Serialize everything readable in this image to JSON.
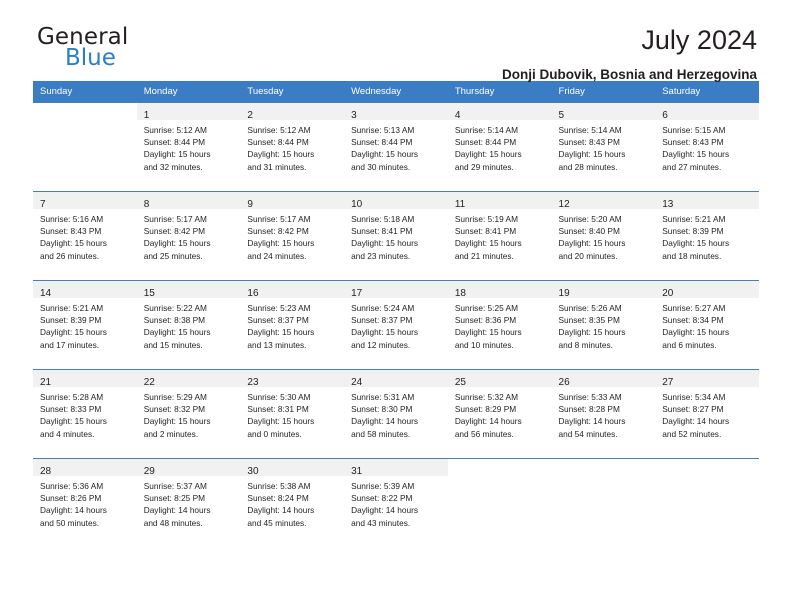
{
  "brand": {
    "name_top": "General",
    "name_bottom": "Blue",
    "triangle_color": "#1b6cb5",
    "blue_color": "#2a7fc9"
  },
  "header": {
    "title": "July 2024",
    "location": "Donji Dubovik, Bosnia and Herzegovina"
  },
  "theme": {
    "header_row_bg": "#3b7dc4",
    "cell_top_border": "#4a7ebb",
    "daynum_bg": "#f1f1f1"
  },
  "weekdays": [
    "Sunday",
    "Monday",
    "Tuesday",
    "Wednesday",
    "Thursday",
    "Friday",
    "Saturday"
  ],
  "weeks": [
    [
      {
        "day": "",
        "sunrise": "",
        "sunset": "",
        "daylight1": "",
        "daylight2": ""
      },
      {
        "day": "1",
        "sunrise": "Sunrise: 5:12 AM",
        "sunset": "Sunset: 8:44 PM",
        "daylight1": "Daylight: 15 hours",
        "daylight2": "and 32 minutes."
      },
      {
        "day": "2",
        "sunrise": "Sunrise: 5:12 AM",
        "sunset": "Sunset: 8:44 PM",
        "daylight1": "Daylight: 15 hours",
        "daylight2": "and 31 minutes."
      },
      {
        "day": "3",
        "sunrise": "Sunrise: 5:13 AM",
        "sunset": "Sunset: 8:44 PM",
        "daylight1": "Daylight: 15 hours",
        "daylight2": "and 30 minutes."
      },
      {
        "day": "4",
        "sunrise": "Sunrise: 5:14 AM",
        "sunset": "Sunset: 8:44 PM",
        "daylight1": "Daylight: 15 hours",
        "daylight2": "and 29 minutes."
      },
      {
        "day": "5",
        "sunrise": "Sunrise: 5:14 AM",
        "sunset": "Sunset: 8:43 PM",
        "daylight1": "Daylight: 15 hours",
        "daylight2": "and 28 minutes."
      },
      {
        "day": "6",
        "sunrise": "Sunrise: 5:15 AM",
        "sunset": "Sunset: 8:43 PM",
        "daylight1": "Daylight: 15 hours",
        "daylight2": "and 27 minutes."
      }
    ],
    [
      {
        "day": "7",
        "sunrise": "Sunrise: 5:16 AM",
        "sunset": "Sunset: 8:43 PM",
        "daylight1": "Daylight: 15 hours",
        "daylight2": "and 26 minutes."
      },
      {
        "day": "8",
        "sunrise": "Sunrise: 5:17 AM",
        "sunset": "Sunset: 8:42 PM",
        "daylight1": "Daylight: 15 hours",
        "daylight2": "and 25 minutes."
      },
      {
        "day": "9",
        "sunrise": "Sunrise: 5:17 AM",
        "sunset": "Sunset: 8:42 PM",
        "daylight1": "Daylight: 15 hours",
        "daylight2": "and 24 minutes."
      },
      {
        "day": "10",
        "sunrise": "Sunrise: 5:18 AM",
        "sunset": "Sunset: 8:41 PM",
        "daylight1": "Daylight: 15 hours",
        "daylight2": "and 23 minutes."
      },
      {
        "day": "11",
        "sunrise": "Sunrise: 5:19 AM",
        "sunset": "Sunset: 8:41 PM",
        "daylight1": "Daylight: 15 hours",
        "daylight2": "and 21 minutes."
      },
      {
        "day": "12",
        "sunrise": "Sunrise: 5:20 AM",
        "sunset": "Sunset: 8:40 PM",
        "daylight1": "Daylight: 15 hours",
        "daylight2": "and 20 minutes."
      },
      {
        "day": "13",
        "sunrise": "Sunrise: 5:21 AM",
        "sunset": "Sunset: 8:39 PM",
        "daylight1": "Daylight: 15 hours",
        "daylight2": "and 18 minutes."
      }
    ],
    [
      {
        "day": "14",
        "sunrise": "Sunrise: 5:21 AM",
        "sunset": "Sunset: 8:39 PM",
        "daylight1": "Daylight: 15 hours",
        "daylight2": "and 17 minutes."
      },
      {
        "day": "15",
        "sunrise": "Sunrise: 5:22 AM",
        "sunset": "Sunset: 8:38 PM",
        "daylight1": "Daylight: 15 hours",
        "daylight2": "and 15 minutes."
      },
      {
        "day": "16",
        "sunrise": "Sunrise: 5:23 AM",
        "sunset": "Sunset: 8:37 PM",
        "daylight1": "Daylight: 15 hours",
        "daylight2": "and 13 minutes."
      },
      {
        "day": "17",
        "sunrise": "Sunrise: 5:24 AM",
        "sunset": "Sunset: 8:37 PM",
        "daylight1": "Daylight: 15 hours",
        "daylight2": "and 12 minutes."
      },
      {
        "day": "18",
        "sunrise": "Sunrise: 5:25 AM",
        "sunset": "Sunset: 8:36 PM",
        "daylight1": "Daylight: 15 hours",
        "daylight2": "and 10 minutes."
      },
      {
        "day": "19",
        "sunrise": "Sunrise: 5:26 AM",
        "sunset": "Sunset: 8:35 PM",
        "daylight1": "Daylight: 15 hours",
        "daylight2": "and 8 minutes."
      },
      {
        "day": "20",
        "sunrise": "Sunrise: 5:27 AM",
        "sunset": "Sunset: 8:34 PM",
        "daylight1": "Daylight: 15 hours",
        "daylight2": "and 6 minutes."
      }
    ],
    [
      {
        "day": "21",
        "sunrise": "Sunrise: 5:28 AM",
        "sunset": "Sunset: 8:33 PM",
        "daylight1": "Daylight: 15 hours",
        "daylight2": "and 4 minutes."
      },
      {
        "day": "22",
        "sunrise": "Sunrise: 5:29 AM",
        "sunset": "Sunset: 8:32 PM",
        "daylight1": "Daylight: 15 hours",
        "daylight2": "and 2 minutes."
      },
      {
        "day": "23",
        "sunrise": "Sunrise: 5:30 AM",
        "sunset": "Sunset: 8:31 PM",
        "daylight1": "Daylight: 15 hours",
        "daylight2": "and 0 minutes."
      },
      {
        "day": "24",
        "sunrise": "Sunrise: 5:31 AM",
        "sunset": "Sunset: 8:30 PM",
        "daylight1": "Daylight: 14 hours",
        "daylight2": "and 58 minutes."
      },
      {
        "day": "25",
        "sunrise": "Sunrise: 5:32 AM",
        "sunset": "Sunset: 8:29 PM",
        "daylight1": "Daylight: 14 hours",
        "daylight2": "and 56 minutes."
      },
      {
        "day": "26",
        "sunrise": "Sunrise: 5:33 AM",
        "sunset": "Sunset: 8:28 PM",
        "daylight1": "Daylight: 14 hours",
        "daylight2": "and 54 minutes."
      },
      {
        "day": "27",
        "sunrise": "Sunrise: 5:34 AM",
        "sunset": "Sunset: 8:27 PM",
        "daylight1": "Daylight: 14 hours",
        "daylight2": "and 52 minutes."
      }
    ],
    [
      {
        "day": "28",
        "sunrise": "Sunrise: 5:36 AM",
        "sunset": "Sunset: 8:26 PM",
        "daylight1": "Daylight: 14 hours",
        "daylight2": "and 50 minutes."
      },
      {
        "day": "29",
        "sunrise": "Sunrise: 5:37 AM",
        "sunset": "Sunset: 8:25 PM",
        "daylight1": "Daylight: 14 hours",
        "daylight2": "and 48 minutes."
      },
      {
        "day": "30",
        "sunrise": "Sunrise: 5:38 AM",
        "sunset": "Sunset: 8:24 PM",
        "daylight1": "Daylight: 14 hours",
        "daylight2": "and 45 minutes."
      },
      {
        "day": "31",
        "sunrise": "Sunrise: 5:39 AM",
        "sunset": "Sunset: 8:22 PM",
        "daylight1": "Daylight: 14 hours",
        "daylight2": "and 43 minutes."
      },
      {
        "day": "",
        "sunrise": "",
        "sunset": "",
        "daylight1": "",
        "daylight2": ""
      },
      {
        "day": "",
        "sunrise": "",
        "sunset": "",
        "daylight1": "",
        "daylight2": ""
      },
      {
        "day": "",
        "sunrise": "",
        "sunset": "",
        "daylight1": "",
        "daylight2": ""
      }
    ]
  ]
}
